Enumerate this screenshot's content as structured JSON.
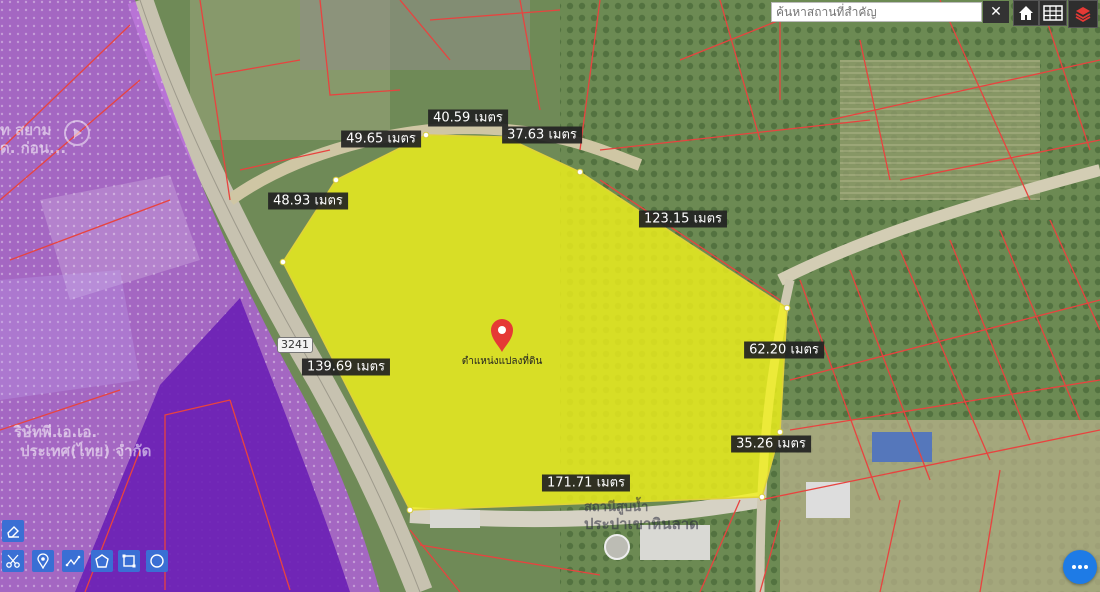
{
  "search": {
    "placeholder": "ค้นหาสถานที่สำคัญ",
    "clear_icon": "close-icon"
  },
  "toolbar": {
    "icons": [
      "home-icon",
      "grid-icon",
      "layers-icon"
    ]
  },
  "road": {
    "number": "3241"
  },
  "marker": {
    "label": "ตำแหน่งแปลงที่ดิน"
  },
  "map_text": {
    "left_top_1": "ท สยาม",
    "left_top_2": "ด. ก่อน...",
    "left_mid_1": "ริษัทพี.เอ.เอ.",
    "left_mid_2": "ประเทศ(ไทย) จำกัด",
    "bottom_1": "สถานีสูบน้ำ",
    "bottom_2": "ประปาเขาหินลาด"
  },
  "dimensions": [
    {
      "id": "d1",
      "text": "40.59 เมตร"
    },
    {
      "id": "d2",
      "text": "49.65 เมตร"
    },
    {
      "id": "d3",
      "text": "37.63 เมตร"
    },
    {
      "id": "d4",
      "text": "48.93 เมตร"
    },
    {
      "id": "d5",
      "text": "123.15 เมตร"
    },
    {
      "id": "d6",
      "text": "62.20 เมตร"
    },
    {
      "id": "d7",
      "text": "139.69 เมตร"
    },
    {
      "id": "d8",
      "text": "35.26 เมตร"
    },
    {
      "id": "d9",
      "text": "171.71 เมตร"
    }
  ],
  "colors": {
    "parcel_fill": "#f2f21a",
    "parcel_stroke": "#e0d23a",
    "boundary_red": "#e8433f",
    "zone_light_purple": "#b45ee0",
    "zone_dark_purple": "#6a1fb5",
    "marker_red": "#e53935",
    "button_blue": "#3a6fd4",
    "fab_blue": "#1e7be6"
  },
  "draw_tools": {
    "icons": [
      "eraser-icon",
      "scissors-icon",
      "pin-icon",
      "measure-line-icon",
      "polygon-icon",
      "rectangle-icon",
      "circle-icon"
    ]
  },
  "fab": {
    "icon": "more-dots-icon"
  }
}
